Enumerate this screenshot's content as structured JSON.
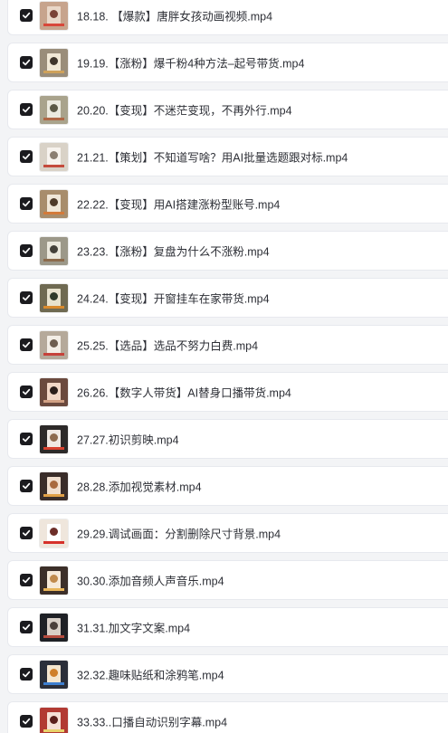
{
  "items": [
    {
      "label": "18.18. 【爆款】唐胖女孩动画视频.mp4",
      "checked": true,
      "thumb": [
        "#c7a48d",
        "#7a4236",
        "#e9d7c8",
        "#d8473a"
      ]
    },
    {
      "label": "19.19.【涨粉】爆千粉4种方法–起号带货.mp4",
      "checked": true,
      "thumb": [
        "#9a8d7a",
        "#3f352b",
        "#f1e8d6",
        "#cfa25b"
      ]
    },
    {
      "label": "20.20.【变现】不迷茫变现，不再外行.mp4",
      "checked": true,
      "thumb": [
        "#a9a38c",
        "#5d5a47",
        "#eceadf",
        "#b06846"
      ]
    },
    {
      "label": "21.21.【策划】不知道写啥？用AI批量选题跟对标.mp4",
      "checked": true,
      "thumb": [
        "#d9d2c7",
        "#8b7f72",
        "#f7f3ee",
        "#c44b3c"
      ]
    },
    {
      "label": "22.22.【变现】用AI搭建涨粉型账号.mp4",
      "checked": true,
      "thumb": [
        "#a88d6c",
        "#4f3b29",
        "#f0e7d8",
        "#d37a3a"
      ]
    },
    {
      "label": "23.23.【涨粉】复盘为什么不涨粉.mp4",
      "checked": true,
      "thumb": [
        "#9c9889",
        "#44413a",
        "#ebe8dd",
        "#8c6b4c"
      ]
    },
    {
      "label": "24.24.【变现】开窗挂车在家带货.mp4",
      "checked": true,
      "thumb": [
        "#6f6a52",
        "#2f3a2a",
        "#e7e2cd",
        "#d98a2c"
      ]
    },
    {
      "label": "25.25.【选品】选品不努力白费.mp4",
      "checked": true,
      "thumb": [
        "#b5a99a",
        "#6e5e50",
        "#f3eee6",
        "#c6423a"
      ]
    },
    {
      "label": "26.26.【数字人带货】AI替身口播带货.mp4",
      "checked": true,
      "thumb": [
        "#6b4a3e",
        "#2b1e1a",
        "#f2d7c6",
        "#d1a184"
      ]
    },
    {
      "label": "27.27.初识剪映.mp4",
      "checked": true,
      "thumb": [
        "#2d2a29",
        "#8e6c4f",
        "#f0eae4",
        "#d8422f"
      ]
    },
    {
      "label": "28.28.添加视觉素材.mp4",
      "checked": true,
      "thumb": [
        "#3a2d2a",
        "#a96a3e",
        "#f1dfcf",
        "#e1a047"
      ]
    },
    {
      "label": "29.29.调试画面：分割删除尺寸背景.mp4",
      "checked": true,
      "thumb": [
        "#efe6dc",
        "#6d2e28",
        "#ffffff",
        "#d6312a"
      ]
    },
    {
      "label": "30.30.添加音频人声音乐.mp4",
      "checked": true,
      "thumb": [
        "#3c2f29",
        "#c08a4c",
        "#f6e9d8",
        "#e8b55a"
      ]
    },
    {
      "label": "31.31.加文字文案.mp4",
      "checked": true,
      "thumb": [
        "#1f2126",
        "#4a3f3a",
        "#d8cfc7",
        "#b54b3e"
      ]
    },
    {
      "label": "32.32.趣味贴纸和涂鸦笔.mp4",
      "checked": true,
      "thumb": [
        "#2b2f3a",
        "#cf7f2a",
        "#f4e6d0",
        "#3d7fd0"
      ]
    },
    {
      "label": "33.33..口播自动识别字幕.mp4",
      "checked": true,
      "thumb": [
        "#b23a33",
        "#5b1f1b",
        "#f6e0d6",
        "#e8d26a"
      ]
    }
  ]
}
